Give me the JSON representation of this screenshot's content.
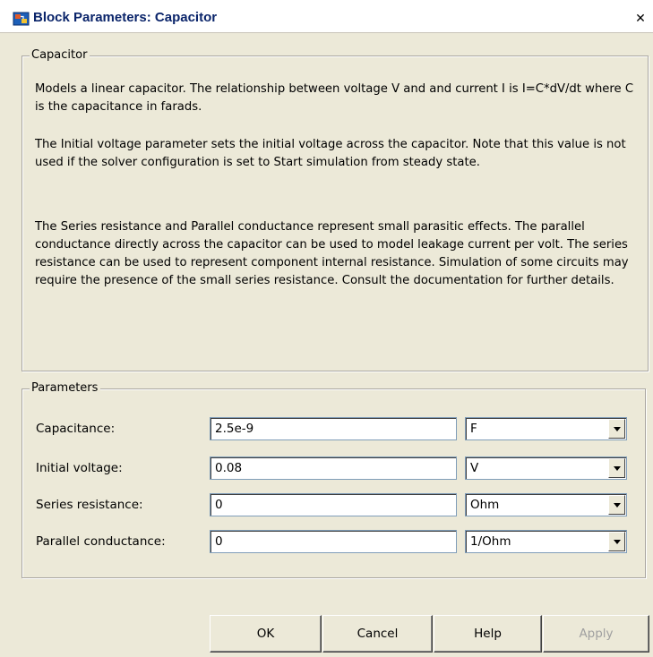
{
  "window": {
    "title": "Block Parameters: Capacitor",
    "close_label": "✕"
  },
  "description_group": {
    "legend": "Capacitor",
    "paragraphs": [
      "Models a linear capacitor. The relationship between voltage V and and current I is I=C*dV/dt where C is the capacitance in farads.",
      "The Initial voltage parameter sets the initial voltage across the capacitor. Note that this value is not used if the solver configuration is set to Start simulation from steady state.",
      "The Series resistance and Parallel conductance represent small parasitic effects. The parallel conductance directly across the capacitor can be used to model leakage current per volt. The series resistance can be used to represent component internal resistance. Simulation of some circuits may require the presence of the small series resistance. Consult the documentation for further details."
    ]
  },
  "parameters_group": {
    "legend": "Parameters",
    "rows": [
      {
        "label": "Capacitance:",
        "value": "2.5e-9",
        "unit": "F"
      },
      {
        "label": "Initial voltage:",
        "value": "0.08",
        "unit": "V"
      },
      {
        "label": "Series resistance:",
        "value": "0",
        "unit": "Ohm"
      },
      {
        "label": "Parallel conductance:",
        "value": "0",
        "unit": "1/Ohm"
      }
    ]
  },
  "buttons": {
    "ok": "OK",
    "cancel": "Cancel",
    "help": "Help",
    "apply": "Apply"
  },
  "icons": {
    "title_icon": "simulink-block-icon",
    "close_icon": "close-icon",
    "dropdown_icon": "chevron-down-icon"
  },
  "colors": {
    "title_text": "#0a246a",
    "dialog_background": "#ece9d8",
    "disabled_text": "#a0a0a0"
  }
}
